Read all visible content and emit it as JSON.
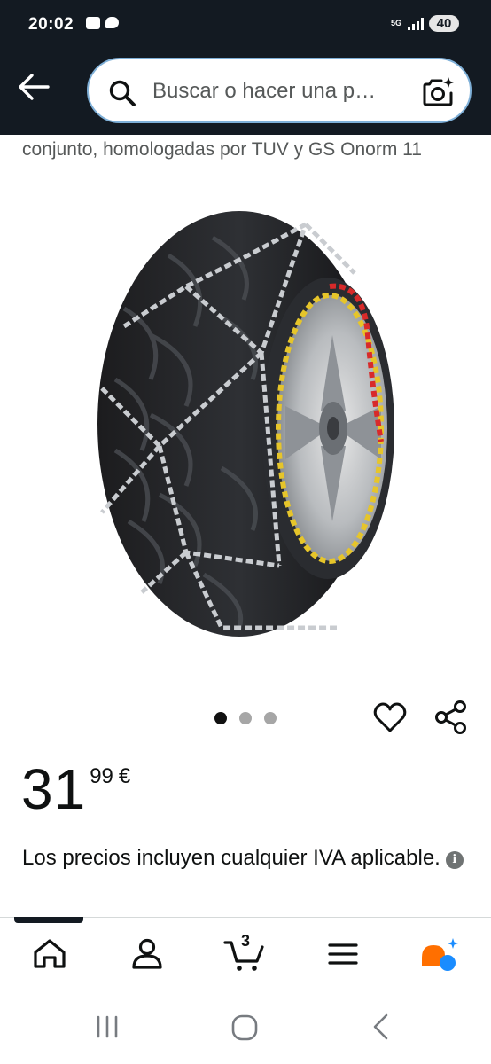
{
  "status_bar": {
    "time": "20:02",
    "network_label": "5G",
    "battery": "40"
  },
  "header": {
    "search_placeholder": "Buscar o hacer una p…",
    "back_icon": "arrow-left-icon",
    "search_icon": "search-icon",
    "camera_icon": "camera-sparkle-icon"
  },
  "product": {
    "description_tail": "conjunto, homologadas por TUV y GS Onorm 11",
    "image_alt": "Cadenas de nieve montadas en neumático",
    "carousel": {
      "count": 3,
      "active": 1
    },
    "price": {
      "whole": "31",
      "fraction": "99",
      "currency": "€"
    },
    "tax_note": "Los precios incluyen cualquier IVA aplicable."
  },
  "bottom_nav": {
    "items": [
      "home-icon",
      "account-icon",
      "cart-icon",
      "menu-icon",
      "rufus-icon"
    ],
    "cart_count": "3",
    "active_index": 0
  },
  "colors": {
    "header_bg": "#131a22",
    "search_border": "#7fb0d8",
    "rufus_orange": "#ff6f00",
    "rufus_blue": "#1a8cff"
  }
}
